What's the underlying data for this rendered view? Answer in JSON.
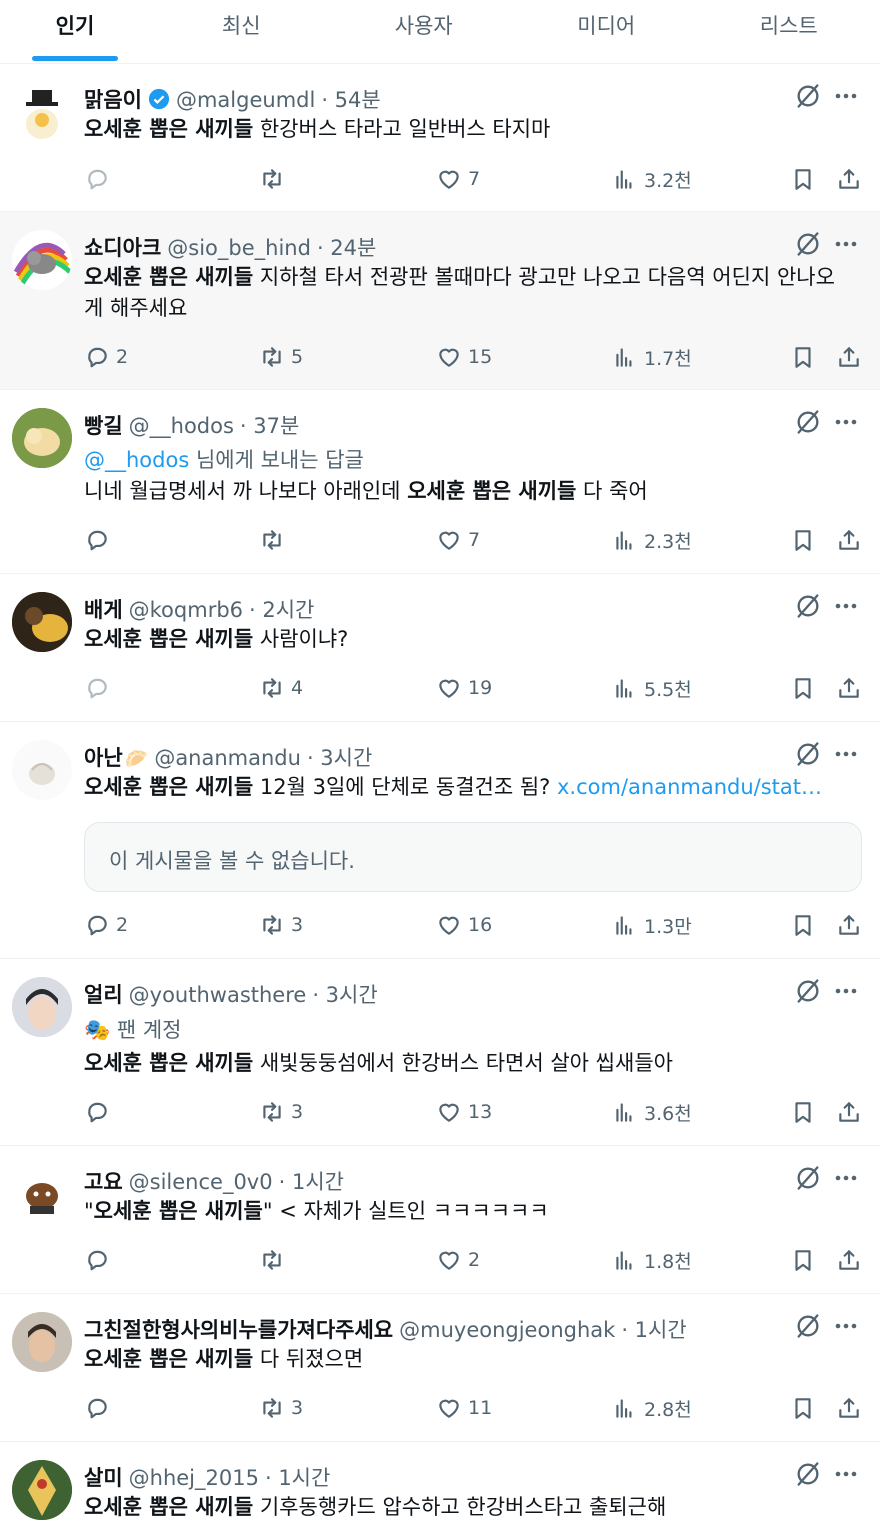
{
  "tabs": [
    {
      "label": "인기",
      "active": true
    },
    {
      "label": "최신",
      "active": false
    },
    {
      "label": "사용자",
      "active": false
    },
    {
      "label": "미디어",
      "active": false
    },
    {
      "label": "리스트",
      "active": false
    }
  ],
  "colors": {
    "accent": "#1d9bf0",
    "text": "#0f1419",
    "muted": "#536471"
  },
  "tweets": [
    {
      "name": "맑음이",
      "verified": true,
      "handle": "@malgeumdl",
      "time": "· 54분",
      "bold": "오세훈 뽑은 새끼들",
      "text": " 한강버스 타라고 일반버스 타지마",
      "reply": "",
      "retweet": "",
      "like": "7",
      "views": "3.2천"
    },
    {
      "name": "쇼디아크",
      "handle": "@sio_be_hind",
      "time": "· 24분",
      "bold": "오세훈 뽑은 새끼들",
      "text": " 지하철 타서 전광판 볼때마다 광고만 나오고 다음역 어딘지 안나오게 해주세요",
      "reply": "2",
      "retweet": "5",
      "like": "15",
      "views": "1.7천"
    },
    {
      "name": "빵길",
      "handle": "@__hodos",
      "time": "· 37분",
      "reply_to": "@__hodos",
      "reply_to_suffix": " 님에게 보내는 답글",
      "pre": "니네 월급명세서 까 나보다 아래인데 ",
      "bold": "오세훈 뽑은 새끼들",
      "text": " 다 죽어",
      "reply": "",
      "retweet": "",
      "like": "7",
      "views": "2.3천"
    },
    {
      "name": "배게",
      "handle": "@koqmrb6",
      "time": "· 2시간",
      "bold": "오세훈 뽑은 새끼들",
      "text": " 사람이냐?",
      "reply": "",
      "retweet": "4",
      "like": "19",
      "views": "5.5천"
    },
    {
      "name": "아난",
      "emoji": "🥟",
      "handle": "@ananmandu",
      "time": "· 3시간",
      "bold": "오세훈 뽑은 새끼들",
      "text": " 12월 3일에 단체로 동결건조 됨? ",
      "link": "x.com/ananmandu/stat…",
      "card": "이 게시물을 볼 수 없습니다.",
      "reply": "2",
      "retweet": "3",
      "like": "16",
      "views": "1.3만"
    },
    {
      "name": "얼리",
      "handle": "@youthwasthere",
      "time": "· 3시간",
      "fan": "🎭 팬 계정",
      "bold": "오세훈 뽑은 새끼들",
      "text": " 새빛둥둥섬에서 한강버스 타면서 살아 씹새들아",
      "reply": "",
      "retweet": "3",
      "like": "13",
      "views": "3.6천"
    },
    {
      "name": "고요",
      "handle": "@silence_0v0",
      "time": "· 1시간",
      "pre": "\"",
      "bold": "오세훈 뽑은 새끼들",
      "text": "\" < 자체가 실트인 ㅋㅋㅋㅋㅋㅋ",
      "reply": "",
      "retweet": "",
      "like": "2",
      "views": "1.8천"
    },
    {
      "name": "그친절한형사의비누를가져다주세요",
      "handle": "@muyeongjeonghak",
      "time": "· 1시간",
      "bold": "오세훈 뽑은 새끼들",
      "text": " 다 뒤졌으면",
      "reply": "",
      "retweet": "3",
      "like": "11",
      "views": "2.8천"
    },
    {
      "name": "살미",
      "handle": "@hhej_2015",
      "time": "· 1시간",
      "bold": "오세훈 뽑은 새끼들",
      "text": " 기후동행카드 압수하고 한강버스타고 출퇴근해"
    }
  ]
}
